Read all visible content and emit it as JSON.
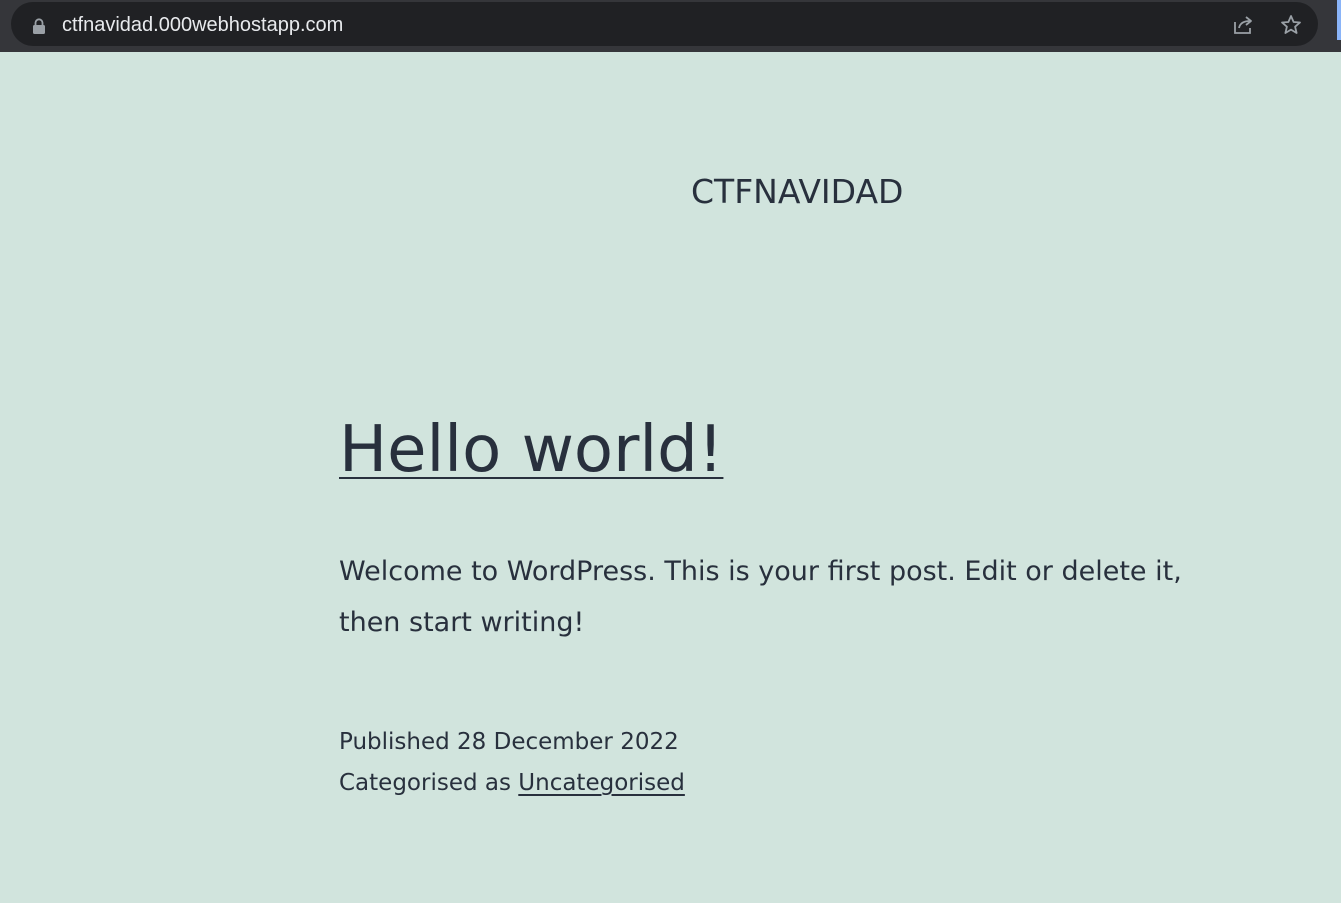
{
  "browser": {
    "url": "ctfnavidad.000webhostapp.com"
  },
  "site": {
    "title": "CTFNAVIDAD"
  },
  "post": {
    "title": "Hello world!",
    "content": "Welcome to WordPress. This is your first post. Edit or delete it, then start writing!",
    "published_label": "Published",
    "published_date": "28 December 2022",
    "category_prefix": "Categorised as",
    "category": "Uncategorised"
  },
  "colors": {
    "background": "#d1e4dd",
    "text": "#28303d",
    "browser_bar": "#35363a",
    "omnibox": "#202124"
  }
}
